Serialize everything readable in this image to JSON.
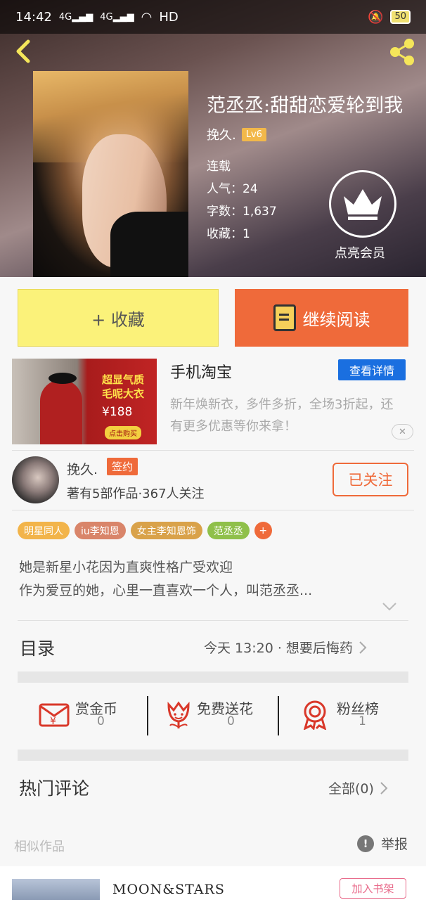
{
  "status_bar": {
    "time": "14:42",
    "network1": "4G",
    "network2": "4G",
    "hd": "HD",
    "battery": "50"
  },
  "book": {
    "title": "范丞丞:甜甜恋爱轮到我",
    "author": "挽久.",
    "level": "Lv6",
    "status": "连载",
    "popularity": "人气：24",
    "word_count": "字数：1,637",
    "favorites": "收藏：1"
  },
  "vip": {
    "label": "点亮会员"
  },
  "actions": {
    "collect_label": "+ 收藏",
    "read_label": "继续阅读"
  },
  "ad": {
    "image_text": "超显气质毛呢大衣",
    "image_price": "¥188",
    "image_buy": "点击购买",
    "title": "手机淘宝",
    "detail_label": "查看详情",
    "desc": "新年焕新衣，多件多折，全场3折起，还有更多优惠等你来拿！",
    "close": "✕"
  },
  "author": {
    "name": "挽久.",
    "badge": "签约",
    "stats": "著有5部作品·367人关注",
    "follow_label": "已关注"
  },
  "tags": [
    {
      "label": "明星同人",
      "color": "#f2b44a"
    },
    {
      "label": "iu李知恩",
      "color": "#d9856a"
    },
    {
      "label": "女主李知恩饰",
      "color": "#d9a24a"
    },
    {
      "label": "范丞丞",
      "color": "#8fc04a"
    },
    {
      "label": "+",
      "color": "#ef6a3a"
    }
  ],
  "synopsis": {
    "line1": "她是新星小花因为直爽性格广受欢迎",
    "line2": "作为爱豆的她，心里一直喜欢一个人，叫范丞丞..."
  },
  "toc": {
    "label": "目录",
    "latest": "今天 13:20 · 想要后悔药"
  },
  "stats": [
    {
      "label": "赏金币",
      "value": "0",
      "icon": "red-envelope-icon"
    },
    {
      "label": "免费送花",
      "value": "0",
      "icon": "flower-icon"
    },
    {
      "label": "粉丝榜",
      "value": "1",
      "icon": "medal-icon"
    }
  ],
  "comments": {
    "label": "热门评论",
    "all_label": "全部(0)"
  },
  "similar": {
    "label": "相似作品",
    "report_label": "举报"
  },
  "similar_book": {
    "title": "MOON&STARS",
    "add_label": "加入书架"
  }
}
